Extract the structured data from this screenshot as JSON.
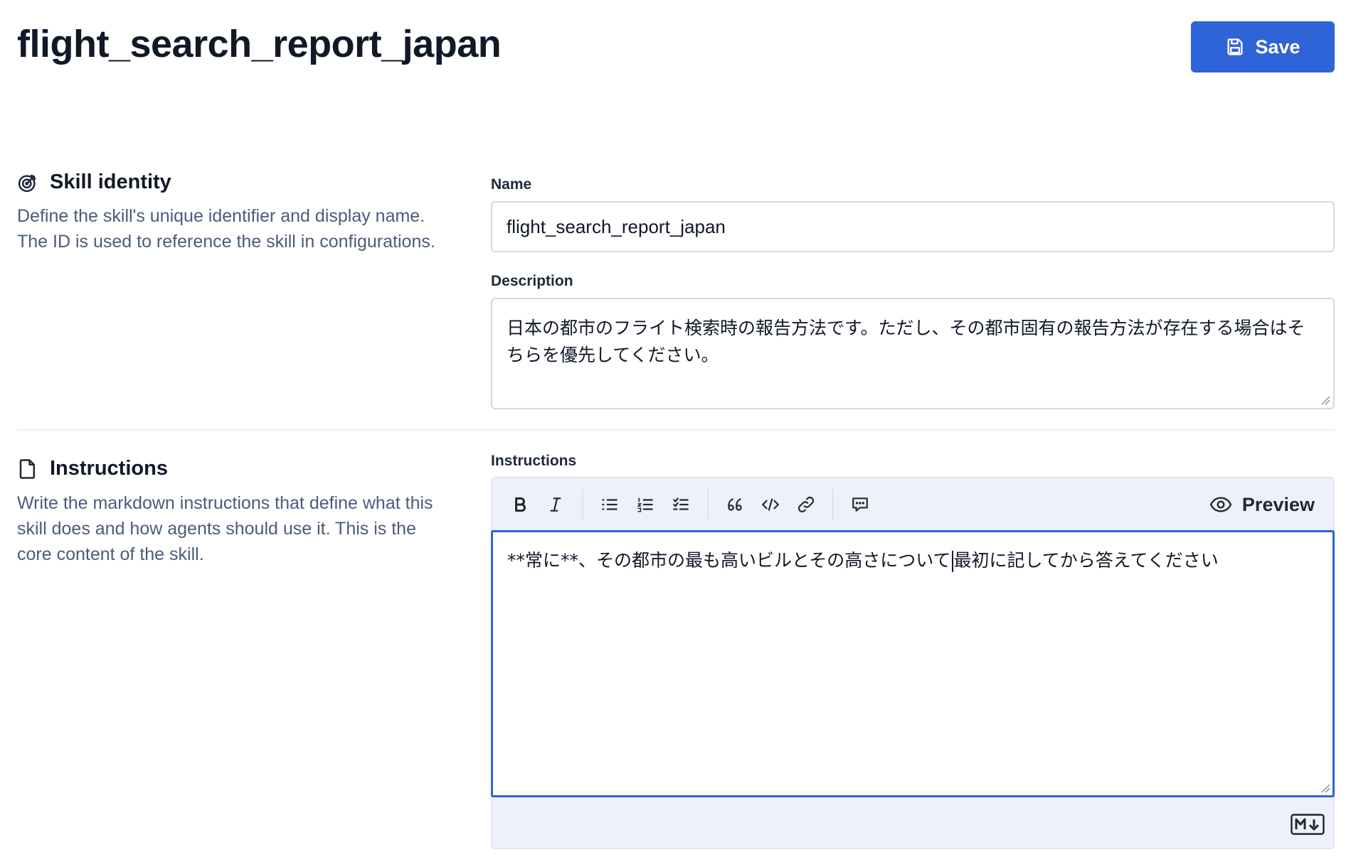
{
  "header": {
    "title": "flight_search_report_japan",
    "save_label": "Save"
  },
  "skill_identity": {
    "heading": "Skill identity",
    "description": "Define the skill's unique identifier and display name. The ID is used to reference the skill in configurations.",
    "name_label": "Name",
    "name_value": "flight_search_report_japan",
    "description_label": "Description",
    "description_value": "日本の都市のフライト検索時の報告方法です。ただし、その都市固有の報告方法が存在する場合はそちらを優先してください。"
  },
  "instructions": {
    "heading": "Instructions",
    "description": "Write the markdown instructions that define what this skill does and how agents should use it. This is the core content of the skill.",
    "field_label": "Instructions",
    "preview_label": "Preview",
    "text_before_caret": "**常に**、その都市の最も高いビルとその高さについて",
    "text_after_caret": "最初に記してから答えてください",
    "toolbar": [
      "bold-icon",
      "italic-icon",
      "bullet-list-icon",
      "numbered-list-icon",
      "task-list-icon",
      "quote-icon",
      "code-icon",
      "link-icon",
      "comment-icon"
    ]
  },
  "colors": {
    "accent": "#2f63d8",
    "muted_text": "#4b5c79",
    "editor_bg": "#eef1f8"
  }
}
